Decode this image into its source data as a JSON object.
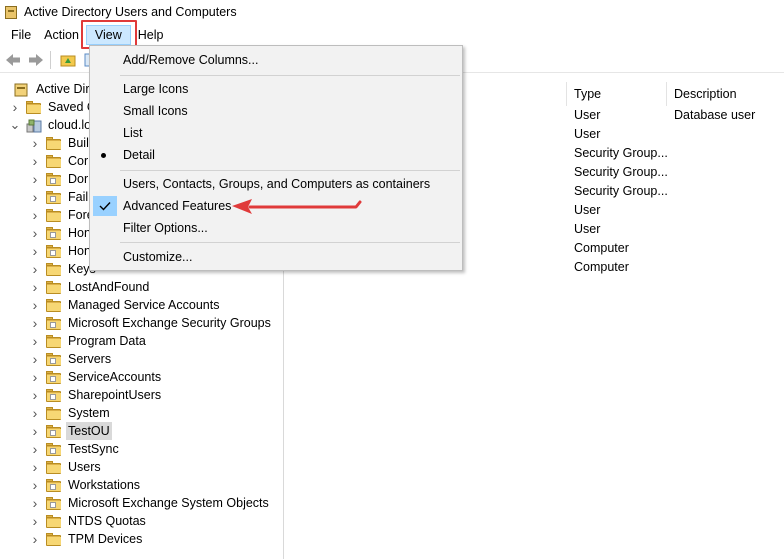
{
  "window": {
    "title": "Active Directory Users and Computers"
  },
  "menubar": {
    "file": "File",
    "action": "Action",
    "view": "View",
    "help": "Help"
  },
  "toolbar": {
    "buttons": [
      "back-icon",
      "forward-icon",
      "up-folder-icon",
      "console-tree-icon"
    ]
  },
  "tree": {
    "items": [
      {
        "label": "Active Directo",
        "kind": "root"
      },
      {
        "label": "Saved Q",
        "kind": "folder",
        "expandable": true
      },
      {
        "label": "cloud.lo",
        "kind": "domain",
        "expanded": true
      },
      {
        "label": "Buil",
        "kind": "folder"
      },
      {
        "label": "Cor",
        "kind": "folder"
      },
      {
        "label": "Dor",
        "kind": "ou"
      },
      {
        "label": "Fail",
        "kind": "ou"
      },
      {
        "label": "Fore",
        "kind": "folder"
      },
      {
        "label": "Hon",
        "kind": "ou"
      },
      {
        "label": "Hon",
        "kind": "ou"
      },
      {
        "label": "Keys",
        "kind": "folder"
      },
      {
        "label": "LostAndFound",
        "kind": "folder"
      },
      {
        "label": "Managed Service Accounts",
        "kind": "folder"
      },
      {
        "label": "Microsoft Exchange Security Groups",
        "kind": "ou"
      },
      {
        "label": "Program Data",
        "kind": "folder"
      },
      {
        "label": "Servers",
        "kind": "ou"
      },
      {
        "label": "ServiceAccounts",
        "kind": "ou"
      },
      {
        "label": "SharepointUsers",
        "kind": "ou"
      },
      {
        "label": "System",
        "kind": "folder"
      },
      {
        "label": "TestOU",
        "kind": "ou",
        "selected": true
      },
      {
        "label": "TestSync",
        "kind": "ou"
      },
      {
        "label": "Users",
        "kind": "folder"
      },
      {
        "label": "Workstations",
        "kind": "ou"
      },
      {
        "label": "Microsoft Exchange System Objects",
        "kind": "ou"
      },
      {
        "label": "NTDS Quotas",
        "kind": "folder"
      },
      {
        "label": "TPM Devices",
        "kind": "folder"
      }
    ]
  },
  "list": {
    "columns": {
      "type": "Type",
      "description": "Description"
    },
    "rows": [
      {
        "type": "User",
        "description": "Database user"
      },
      {
        "type": "User",
        "description": ""
      },
      {
        "type": "Security Group...",
        "description": ""
      },
      {
        "type": "Security Group...",
        "description": ""
      },
      {
        "type": "Security Group...",
        "description": ""
      },
      {
        "type": "User",
        "description": ""
      },
      {
        "type": "User",
        "description": ""
      },
      {
        "type": "Computer",
        "description": ""
      },
      {
        "type": "Computer",
        "description": ""
      }
    ]
  },
  "view_menu": {
    "add_remove_columns": "Add/Remove Columns...",
    "large_icons": "Large Icons",
    "small_icons": "Small Icons",
    "list": "List",
    "detail": "Detail",
    "containers": "Users, Contacts, Groups, and Computers as containers",
    "advanced_features": "Advanced Features",
    "filter_options": "Filter Options...",
    "customize": "Customize..."
  },
  "colors": {
    "highlight": "#e03a3a",
    "check_bg": "#99d1ff",
    "menu_active": "#cce8ff"
  }
}
